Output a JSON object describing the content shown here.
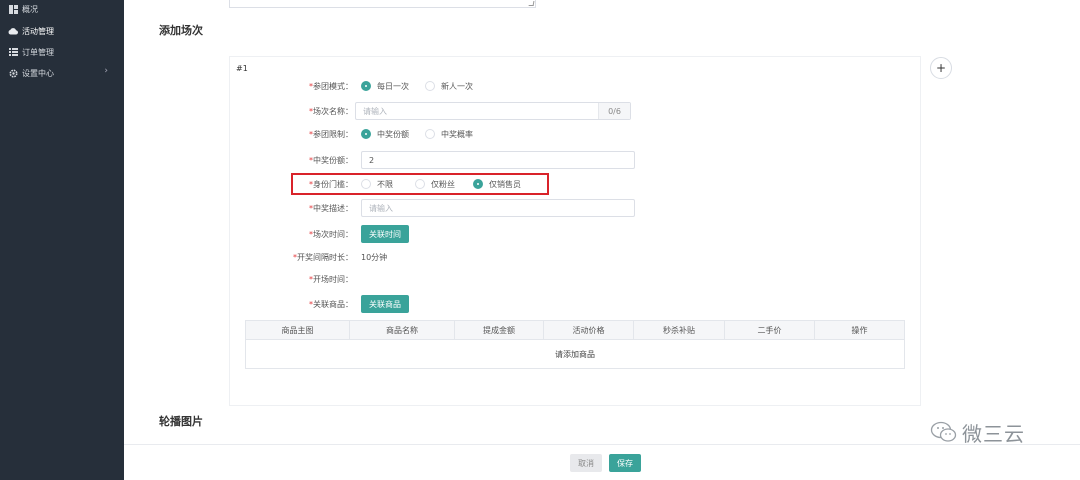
{
  "sidebar": {
    "items": [
      {
        "label": "概况",
        "icon": "grid-icon"
      },
      {
        "label": "活动管理",
        "icon": "cloud-icon"
      },
      {
        "label": "订单管理",
        "icon": "list-icon"
      },
      {
        "label": "设置中心",
        "icon": "gear-icon",
        "has_arrow": true
      }
    ]
  },
  "section_add_session": "添加场次",
  "section_carousel": "轮播图片",
  "card": {
    "index": "#1",
    "rows": {
      "mode": {
        "label": "参团模式：",
        "options": [
          "每日一次",
          "新人一次"
        ],
        "selected": 0
      },
      "name": {
        "label": "场次名称：",
        "placeholder": "请输入",
        "counter": "0/6"
      },
      "limit": {
        "label": "参团限制：",
        "options": [
          "中奖份额",
          "中奖概率"
        ],
        "selected": 0
      },
      "quota": {
        "label": "中奖份额：",
        "value": "2"
      },
      "identity": {
        "label": "身份门槛：",
        "options": [
          "不限",
          "仅粉丝",
          "仅销售员"
        ],
        "selected": 2
      },
      "desc": {
        "label": "中奖描述：",
        "placeholder": "请输入"
      },
      "time": {
        "label": "场次时间：",
        "button": "关联时间"
      },
      "interval": {
        "label": "开奖间隔时长：",
        "value": "10分钟"
      },
      "open_time": {
        "label": "开场时间："
      },
      "goods": {
        "label": "关联商品：",
        "button": "关联商品"
      }
    },
    "table": {
      "columns": [
        "商品主图",
        "商品名称",
        "提成金额",
        "活动价格",
        "秒杀补贴",
        "二手价",
        "操作"
      ],
      "empty": "请添加商品"
    }
  },
  "footer": {
    "cancel": "取消",
    "save": "保存"
  },
  "watermark": "微三云",
  "colors": {
    "accent": "#3aa39a",
    "highlight": "#d9232a",
    "sidebar": "#262f3a"
  }
}
